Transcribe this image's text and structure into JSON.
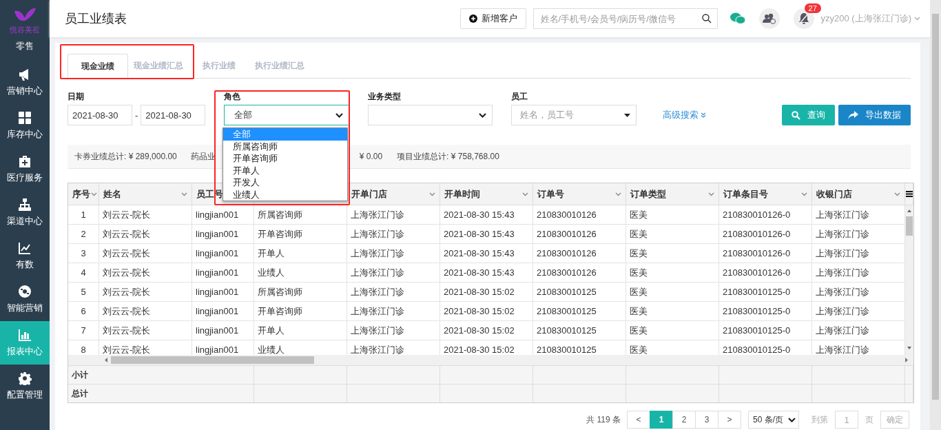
{
  "sidebar": {
    "logo_text": "悦容美莅",
    "items": [
      {
        "label": "零售",
        "selected": false
      },
      {
        "label": "营销中心",
        "selected": false
      },
      {
        "label": "库存中心",
        "selected": false
      },
      {
        "label": "医疗服务",
        "selected": false
      },
      {
        "label": "渠道中心",
        "selected": false
      },
      {
        "label": "有数",
        "selected": false
      },
      {
        "label": "智能营销",
        "selected": false
      },
      {
        "label": "报表中心",
        "selected": true
      },
      {
        "label": "配置管理",
        "selected": false
      }
    ]
  },
  "header": {
    "title": "员工业绩表",
    "new_button": "新增客户",
    "search": {
      "placeholder": "姓名/手机号/会员号/病历号/微信号"
    },
    "notification_count": "27",
    "user": "yzy200 (上海张江门诊)"
  },
  "tabs": [
    {
      "label": "现金业绩",
      "selected": true
    },
    {
      "label": "现金业绩汇总",
      "selected": false
    },
    {
      "label": "执行业绩",
      "selected": false
    },
    {
      "label": "执行业绩汇总",
      "selected": false
    }
  ],
  "filters": {
    "date_label": "日期",
    "date_from": "2021-08-30",
    "date_sep": "-",
    "date_to": "2021-08-30",
    "role_label": "角色",
    "role_value": "全部",
    "type_label": "业务类型",
    "employee_label": "员工",
    "employee_placeholder": "姓名，员工号",
    "advanced": "高级搜索",
    "query_button": "查询",
    "export_button": "导出数据"
  },
  "role_dropdown": {
    "options": [
      {
        "label": "全部",
        "selected": true
      },
      {
        "label": "所属咨询师",
        "selected": false
      },
      {
        "label": "开单咨询师",
        "selected": false
      },
      {
        "label": "开单人",
        "selected": false
      },
      {
        "label": "开发人",
        "selected": false
      },
      {
        "label": "业绩人",
        "selected": false
      }
    ]
  },
  "summary": [
    "卡券业绩总计: ¥ 289,000.00",
    "药品业",
    "¥ 0.00",
    "项目业绩总计: ¥ 758,768.00"
  ],
  "table": {
    "columns": [
      {
        "label": "序号"
      },
      {
        "label": "姓名"
      },
      {
        "label": "员工号"
      },
      {},
      {
        "label": "开单门店"
      },
      {
        "label": "开单时间"
      },
      {
        "label": "订单号"
      },
      {
        "label": "订单类型"
      },
      {
        "label": "订单条目号"
      },
      {
        "label": "收银门店"
      }
    ],
    "rows": [
      [
        "1",
        "刘云云-院长",
        "lingjian001",
        "所属咨询师",
        "上海张江门诊",
        "2021-08-30 15:43",
        "210830010126",
        "医美",
        "210830010126-0",
        "上海张江门诊"
      ],
      [
        "2",
        "刘云云-院长",
        "lingjian001",
        "开单咨询师",
        "上海张江门诊",
        "2021-08-30 15:43",
        "210830010126",
        "医美",
        "210830010126-0",
        "上海张江门诊"
      ],
      [
        "3",
        "刘云云-院长",
        "lingjian001",
        "开单人",
        "上海张江门诊",
        "2021-08-30 15:43",
        "210830010126",
        "医美",
        "210830010126-0",
        "上海张江门诊"
      ],
      [
        "4",
        "刘云云-院长",
        "lingjian001",
        "业绩人",
        "上海张江门诊",
        "2021-08-30 15:43",
        "210830010126",
        "医美",
        "210830010126-0",
        "上海张江门诊"
      ],
      [
        "5",
        "刘云云-院长",
        "lingjian001",
        "所属咨询师",
        "上海张江门诊",
        "2021-08-30 15:02",
        "210830010125",
        "医美",
        "210830010125-0",
        "上海张江门诊"
      ],
      [
        "6",
        "刘云云-院长",
        "lingjian001",
        "开单咨询师",
        "上海张江门诊",
        "2021-08-30 15:02",
        "210830010125",
        "医美",
        "210830010125-0",
        "上海张江门诊"
      ],
      [
        "7",
        "刘云云-院长",
        "lingjian001",
        "开单人",
        "上海张江门诊",
        "2021-08-30 15:02",
        "210830010125",
        "医美",
        "210830010125-0",
        "上海张江门诊"
      ],
      [
        "8",
        "刘云云-院长",
        "lingjian001",
        "业绩人",
        "上海张江门诊",
        "2021-08-30 15:02",
        "210830010125",
        "医美",
        "210830010125-0",
        "上海张江门诊"
      ]
    ],
    "subtotal_label": "小计",
    "total_label": "总计"
  },
  "pagination": {
    "total": "共 119 条",
    "prev": "<",
    "pages": [
      {
        "label": "1",
        "selected": true
      },
      {
        "label": "2",
        "selected": false
      },
      {
        "label": "3",
        "selected": false
      }
    ],
    "next": ">",
    "page_size": "50 条/页",
    "goto_label": "到第",
    "goto_value": "1",
    "page_unit": "页",
    "confirm": "确定"
  }
}
